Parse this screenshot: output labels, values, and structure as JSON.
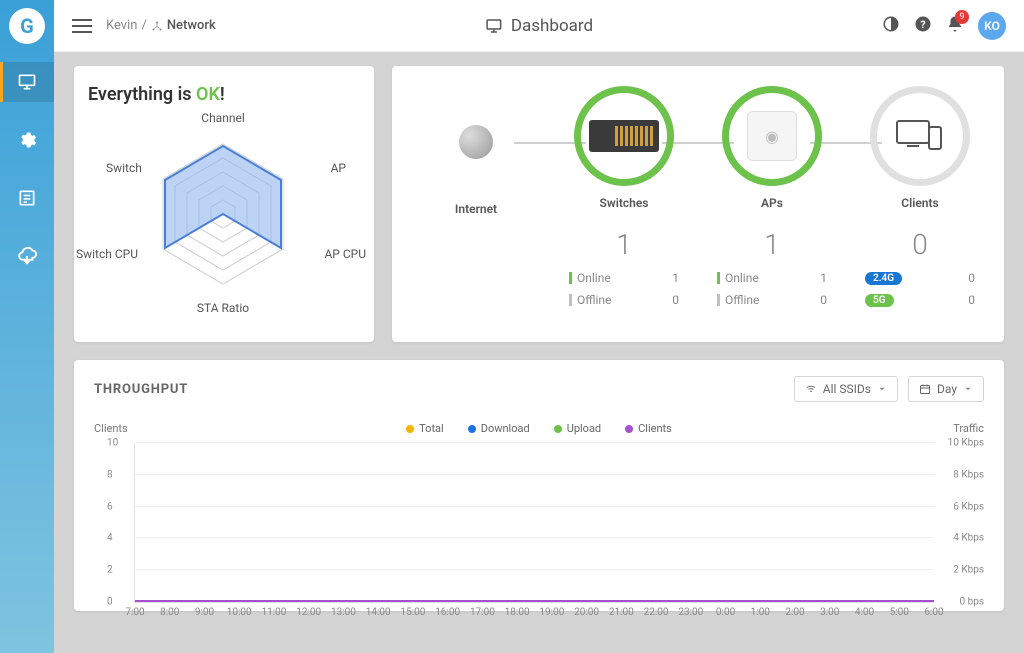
{
  "breadcrumb": {
    "user": "Kevin",
    "network": "Network"
  },
  "page_title": "Dashboard",
  "notif_count": "9",
  "avatar_initials": "KO",
  "status": {
    "prefix": "Everything is ",
    "ok": "OK",
    "suffix": "!"
  },
  "radar_labels": {
    "top": "Channel",
    "tr": "AP",
    "r": "AP CPU",
    "b": "STA Ratio",
    "l": "Switch CPU",
    "tl": "Switch"
  },
  "topology": {
    "internet": {
      "label": "Internet"
    },
    "switches": {
      "label": "Switches",
      "count": "1",
      "online_label": "Online",
      "online": "1",
      "offline_label": "Offline",
      "offline": "0"
    },
    "aps": {
      "label": "APs",
      "count": "1",
      "online_label": "Online",
      "online": "1",
      "offline_label": "Offline",
      "offline": "0"
    },
    "clients": {
      "label": "Clients",
      "count": "0",
      "band24_label": "2.4G",
      "band24": "0",
      "band5_label": "5G",
      "band5": "0"
    }
  },
  "throughput": {
    "title": "THROUGHPUT",
    "ssids_label": "All SSIDs",
    "period_label": "Day",
    "left_label": "Clients",
    "right_label": "Traffic",
    "legend": {
      "total": "Total",
      "download": "Download",
      "upload": "Upload",
      "clients": "Clients"
    }
  },
  "chart_data": {
    "type": "line",
    "categories": [
      "7:00",
      "8:00",
      "9:00",
      "10:00",
      "11:00",
      "12:00",
      "13:00",
      "14:00",
      "15:00",
      "16:00",
      "17:00",
      "18:00",
      "19:00",
      "20:00",
      "21:00",
      "22:00",
      "23:00",
      "0:00",
      "1:00",
      "2:00",
      "3:00",
      "4:00",
      "5:00",
      "6:00"
    ],
    "y_left_ticks": [
      0,
      2,
      4,
      6,
      8,
      10
    ],
    "y_right_ticks": [
      "0 bps",
      "2 Kbps",
      "4 Kbps",
      "6 Kbps",
      "8 Kbps",
      "10 Kbps"
    ],
    "series": [
      {
        "name": "Total",
        "color": "#f5b400",
        "values": [
          0,
          0,
          0,
          0,
          0,
          0,
          0,
          0,
          0,
          0,
          0,
          0,
          0,
          0,
          0,
          0,
          0,
          0,
          0,
          0,
          0,
          0,
          0,
          0
        ]
      },
      {
        "name": "Download",
        "color": "#1a73e8",
        "values": [
          0,
          0,
          0,
          0,
          0,
          0,
          0,
          0,
          0,
          0,
          0,
          0,
          0,
          0,
          0,
          0,
          0,
          0,
          0,
          0,
          0,
          0,
          0,
          0
        ]
      },
      {
        "name": "Upload",
        "color": "#6cc24a",
        "values": [
          0,
          0,
          0,
          0,
          0,
          0,
          0,
          0,
          0,
          0,
          0,
          0,
          0,
          0,
          0,
          0,
          0,
          0,
          0,
          0,
          0,
          0,
          0,
          0
        ]
      },
      {
        "name": "Clients",
        "color": "#a64fd1",
        "values": [
          0,
          0,
          0,
          0,
          0,
          0,
          0,
          0,
          0,
          0,
          0,
          0,
          0,
          0,
          0,
          0,
          0,
          0,
          0,
          0,
          0,
          0,
          0,
          0
        ]
      }
    ],
    "xlabel": "",
    "ylabel_left": "Clients",
    "ylabel_right": "Traffic",
    "ylim": [
      0,
      10
    ]
  }
}
